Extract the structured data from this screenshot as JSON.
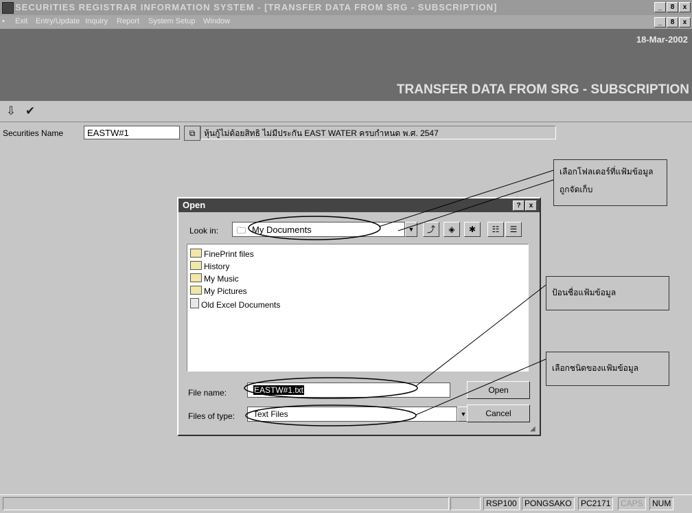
{
  "window": {
    "title": "SECURITIES REGISTRAR INFORMATION SYSTEM - [TRANSFER DATA FROM SRG - SUBSCRIPTION]",
    "controls": [
      "_",
      "8",
      "x"
    ]
  },
  "menu": [
    "Exit",
    "Entry/Update",
    "Inquiry",
    "Report",
    "System Setup",
    "Window"
  ],
  "banner": {
    "date": "18-Mar-2002",
    "title": "TRANSFER DATA FROM SRG - SUBSCRIPTION"
  },
  "toolbar": {
    "icons": [
      "exit-icon",
      "check-icon"
    ]
  },
  "securities": {
    "label": "Securities Name",
    "value": "EASTW#1",
    "description": "หุ้นกู้ไม่ด้อยสิทธิ ไม่มีประกัน EAST WATER ครบกำหนด พ.ศ. 2547"
  },
  "dialog": {
    "title": "Open",
    "title_buttons": [
      "?",
      "x"
    ],
    "look_in_label": "Look in:",
    "look_in_value": "My Documents",
    "files": [
      "FinePrint files",
      "History",
      "My Music",
      "My Pictures",
      "Old Excel Documents"
    ],
    "file_name_label": "File name:",
    "file_name_value": "EASTW#1.txt",
    "files_of_type_label": "Files of type:",
    "files_of_type_value": "Text Files",
    "open_button": "Open",
    "cancel_button": "Cancel"
  },
  "callouts": [
    "เลือกโฟลเดอร์ที่แฟ้มข้อมูลถูกจัดเก็บ",
    "ป้อนชื่อแฟ้มข้อมูล",
    "เลือกชนิดของแฟ้มข้อมูล"
  ],
  "status": {
    "program": "RSP100",
    "user": "PONGSAKO",
    "terminal": "PC2171",
    "caps": "CAPS",
    "num": "NUM"
  }
}
